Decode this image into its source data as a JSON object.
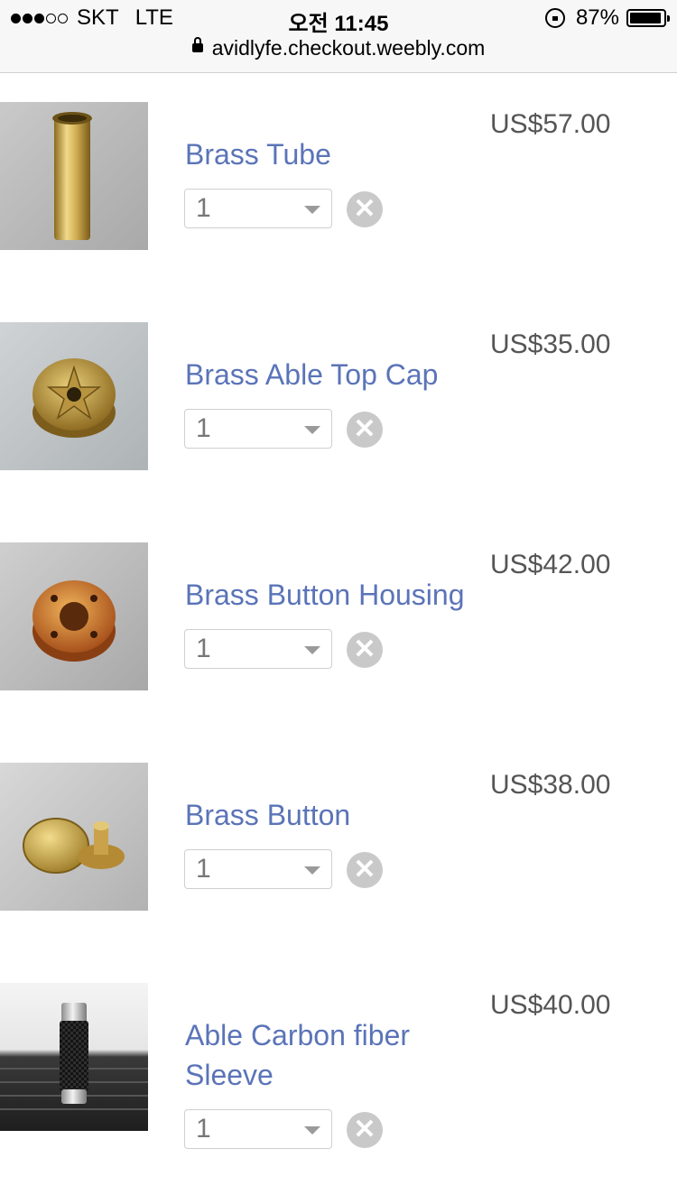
{
  "status": {
    "carrier": "SKT",
    "network": "LTE",
    "time": "오전 11:45",
    "battery": "87%",
    "signal_bars": 3,
    "signal_total": 5
  },
  "browser": {
    "url": "avidlyfe.checkout.weebly.com"
  },
  "cart": {
    "items": [
      {
        "name": "Brass Tube",
        "price": "US$57.00",
        "qty": "1"
      },
      {
        "name": "Brass Able Top Cap",
        "price": "US$35.00",
        "qty": "1"
      },
      {
        "name": "Brass Button Housing",
        "price": "US$42.00",
        "qty": "1"
      },
      {
        "name": "Brass Button",
        "price": "US$38.00",
        "qty": "1"
      },
      {
        "name": "Able Carbon fiber Sleeve",
        "price": "US$40.00",
        "qty": "1"
      }
    ],
    "remove_glyph": "✕"
  }
}
